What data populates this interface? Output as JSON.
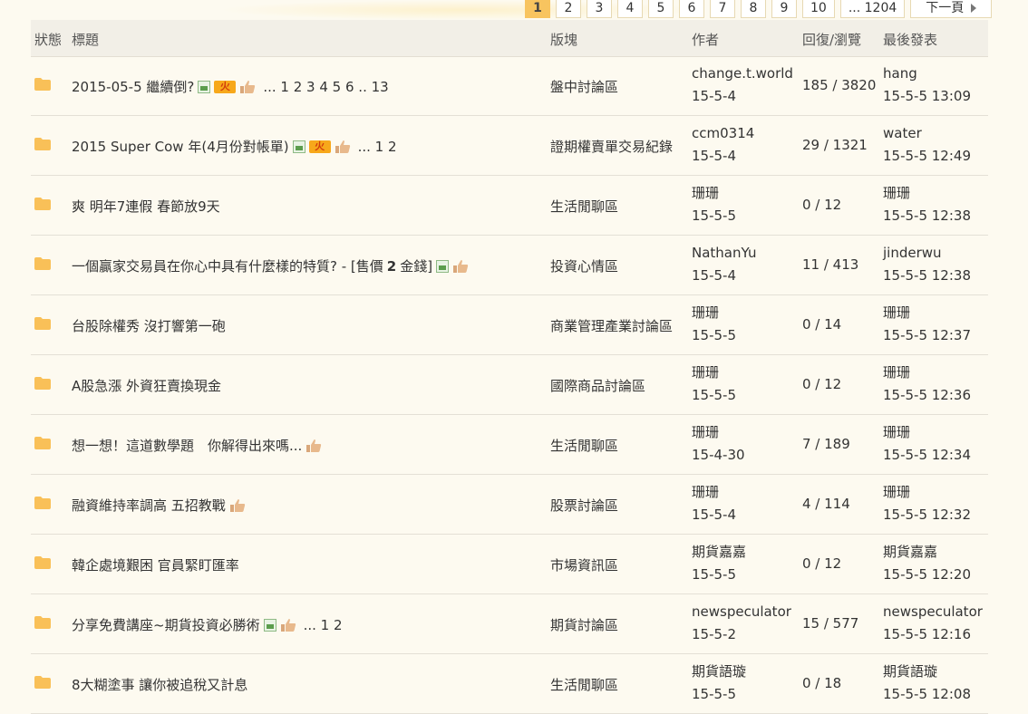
{
  "pagination": {
    "pages": [
      "1",
      "2",
      "3",
      "4",
      "5",
      "6",
      "7",
      "8",
      "9",
      "10"
    ],
    "current": "1",
    "last_label": "... 1204",
    "next_label": "下一頁"
  },
  "columns": {
    "status": "狀態",
    "title": "標題",
    "forum": "版塊",
    "author": "作者",
    "counts": "回復/瀏覽",
    "last": "最後發表"
  },
  "threads": [
    {
      "title": "2015-05-5 繼續倒?",
      "pages": "... 1 2 3 4 5 6 .. 13",
      "forum": "盤中討論區",
      "author": "change.t.world",
      "date": "15-5-4",
      "counts": "185 / 3820",
      "last_user": "hang",
      "last_time": "15-5-5 13:09"
    },
    {
      "title": "2015 Super Cow 年(4月份對帳單)",
      "pages": "... 1 2",
      "forum": "證期權賣單交易紀錄",
      "author": "ccm0314",
      "date": "15-5-4",
      "counts": "29 / 1321",
      "last_user": "water",
      "last_time": "15-5-5 12:49"
    },
    {
      "title": "爽 明年7連假 春節放9天",
      "pages": "",
      "forum": "生活閒聊區",
      "author": "珊珊",
      "date": "15-5-5",
      "counts": "0 / 12",
      "last_user": "珊珊",
      "last_time": "15-5-5 12:38"
    },
    {
      "title": "一個贏家交易員在你心中具有什麼樣的特質? - [售價",
      "price": "2",
      "price_unit": "金錢]",
      "pages": "",
      "forum": "投資心情區",
      "author": "NathanYu",
      "date": "15-5-4",
      "counts": "11 / 413",
      "last_user": "jinderwu",
      "last_time": "15-5-5 12:38"
    },
    {
      "title": "台股除權秀 沒打響第一砲",
      "pages": "",
      "forum": "商業管理產業討論區",
      "author": "珊珊",
      "date": "15-5-5",
      "counts": "0 / 14",
      "last_user": "珊珊",
      "last_time": "15-5-5 12:37"
    },
    {
      "title": "A股急漲 外資狂賣換現金",
      "pages": "",
      "forum": "國際商品討論區",
      "author": "珊珊",
      "date": "15-5-5",
      "counts": "0 / 12",
      "last_user": "珊珊",
      "last_time": "15-5-5 12:36"
    },
    {
      "title": "想一想！這道數學題　你解得出來嗎...",
      "pages": "",
      "forum": "生活閒聊區",
      "author": "珊珊",
      "date": "15-4-30",
      "counts": "7 / 189",
      "last_user": "珊珊",
      "last_time": "15-5-5 12:34"
    },
    {
      "title": "融資維持率調高 五招教戰",
      "pages": "",
      "forum": "股票討論區",
      "author": "珊珊",
      "date": "15-5-4",
      "counts": "4 / 114",
      "last_user": "珊珊",
      "last_time": "15-5-5 12:32"
    },
    {
      "title": "韓企處境艱困 官員緊盯匯率",
      "pages": "",
      "forum": "市場資訊區",
      "author": "期貨嘉嘉",
      "date": "15-5-5",
      "counts": "0 / 12",
      "last_user": "期貨嘉嘉",
      "last_time": "15-5-5 12:20"
    },
    {
      "title": "分享免費講座~期貨投資必勝術",
      "pages": "... 1 2",
      "forum": "期貨討論區",
      "author": "newspeculator",
      "date": "15-5-2",
      "counts": "15 / 577",
      "last_user": "newspeculator",
      "last_time": "15-5-5 12:16"
    },
    {
      "title": "8大糊塗事 讓你被追稅又計息",
      "pages": "",
      "forum": "生活閒聊區",
      "author": "期貨語璇",
      "date": "15-5-5",
      "counts": "0 / 18",
      "last_user": "期貨語璇",
      "last_time": "15-5-5 12:08"
    }
  ],
  "icons": {
    "folder": "folder-icon",
    "image": "image-attachment-icon",
    "hot": "hot-thread-icon",
    "thumb": "thumbs-up-icon"
  },
  "colors": {
    "accent": "#f8c45f",
    "folder": "#f9c058"
  }
}
